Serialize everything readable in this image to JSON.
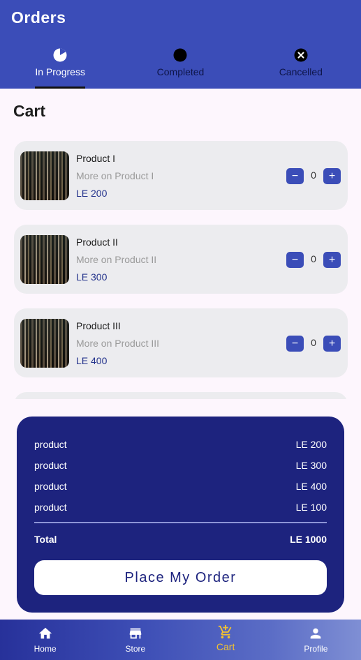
{
  "app_bar": {
    "title": "Orders"
  },
  "tabs": [
    {
      "label": "In Progress",
      "icon": "pie-progress-icon",
      "active": true
    },
    {
      "label": "Completed",
      "icon": "filled-circle-icon",
      "active": false
    },
    {
      "label": "Cancelled",
      "icon": "cancel-circle-icon",
      "active": false
    }
  ],
  "cart": {
    "title": "Cart",
    "items": [
      {
        "name": "Product I",
        "description": "More on Product I",
        "price": "LE 200",
        "quantity": "0"
      },
      {
        "name": "Product II",
        "description": "More on Product II",
        "price": "LE 300",
        "quantity": "0"
      },
      {
        "name": "Product III",
        "description": "More on Product III",
        "price": "LE 400",
        "quantity": "0"
      }
    ],
    "minus_label": "−",
    "plus_label": "+"
  },
  "summary": {
    "lines": [
      {
        "label": "product",
        "amount": "LE 200"
      },
      {
        "label": "product",
        "amount": "LE 300"
      },
      {
        "label": "product",
        "amount": "LE 400"
      },
      {
        "label": "product",
        "amount": "LE 100"
      }
    ],
    "total_label": "Total",
    "total_amount": "LE 1000",
    "button_label": "Place My Order"
  },
  "bottom_nav": [
    {
      "label": "Home",
      "icon": "home-icon",
      "active": false
    },
    {
      "label": "Store",
      "icon": "store-icon",
      "active": false
    },
    {
      "label": "Cart",
      "icon": "cart-add-icon",
      "active": true
    },
    {
      "label": "Profile",
      "icon": "person-icon",
      "active": false
    }
  ],
  "colors": {
    "primary": "#3b4db8",
    "summary_bg": "#1d237e",
    "accent": "#f2c230",
    "background": "#fdf6fd",
    "card_bg": "#ececef"
  }
}
